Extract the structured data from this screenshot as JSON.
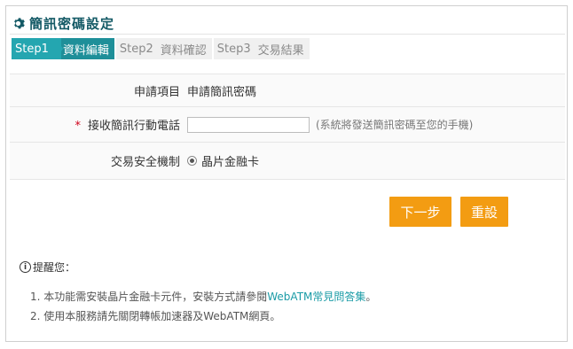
{
  "page": {
    "title": "簡訊密碼設定"
  },
  "steps": [
    {
      "num": "Step1",
      "name": "資料編輯",
      "active": true
    },
    {
      "num": "Step2",
      "name": "資料確認",
      "active": false
    },
    {
      "num": "Step3",
      "name": "交易結果",
      "active": false
    }
  ],
  "form": {
    "apply_item_label": "申請項目",
    "apply_item_value": "申請簡訊密碼",
    "required_mark": "*",
    "phone_label": "接收簡訊行動電話",
    "phone_value": "",
    "phone_hint": "(系統將發送簡訊密碼至您的手機)",
    "security_label": "交易安全機制",
    "security_value": "晶片金融卡"
  },
  "buttons": {
    "next": "下一步",
    "reset": "重設"
  },
  "notice": {
    "icon": "i",
    "title": "提醒您：",
    "item1_prefix": "1. 本功能需安裝晶片金融卡元件，安裝方式請參閱",
    "item1_link": "WebATM常見問答集",
    "item1_suffix": "。",
    "item2": "2. 使用本服務請先關閉轉帳加速器及WebATM網頁。"
  },
  "colors": {
    "accent_teal": "#24a6b0",
    "button_orange": "#f39c12",
    "title_color": "#145a66",
    "link_color": "#1a9ba6"
  }
}
